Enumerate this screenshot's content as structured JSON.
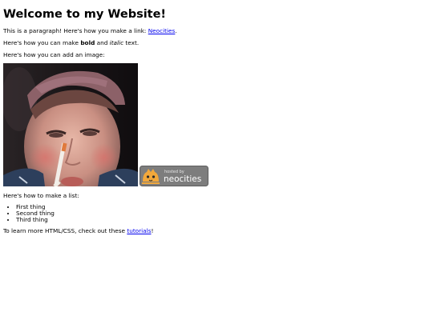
{
  "page": {
    "heading": "Welcome to my Website!",
    "intro_text": "This is a paragraph! Here's how you make a link: ",
    "intro_link": "Neocities",
    "intro_end": ".",
    "format_prefix": "Here's how you can make ",
    "format_bold": "bold",
    "format_middle": " and ",
    "format_italic": "italic",
    "format_suffix": " text.",
    "image_intro": "Here's how you can add an image:",
    "badge": {
      "small_text": "hosted by",
      "brand_text": "neocities"
    },
    "list_intro": "Here's how to make a list:",
    "list_items": [
      "First thing",
      "Second thing",
      "Third thing"
    ],
    "outro_text": "To learn more HTML/CSS, check out these ",
    "outro_link": "tutorials",
    "outro_end": "!"
  }
}
